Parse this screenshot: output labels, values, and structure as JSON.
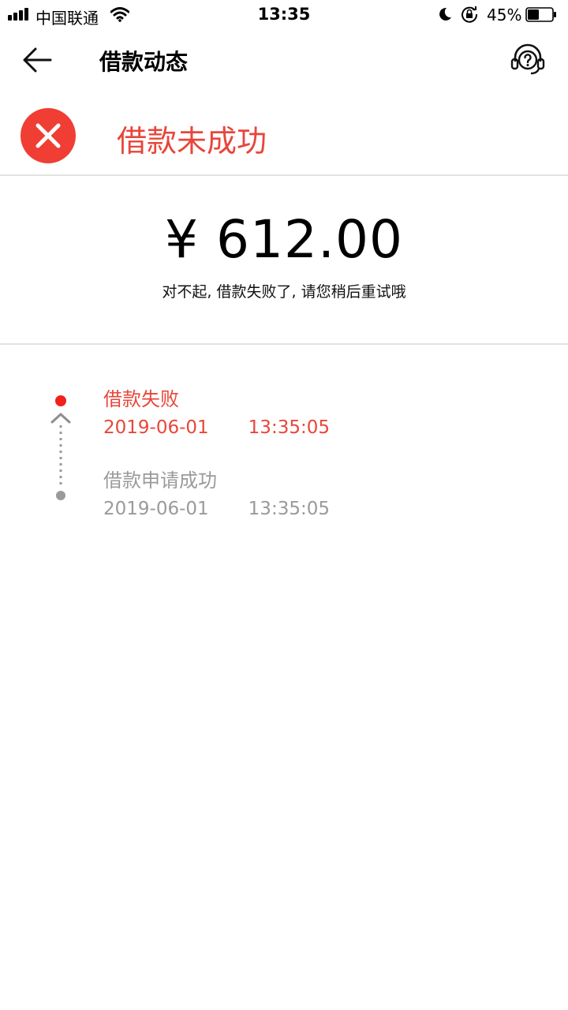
{
  "status_bar": {
    "carrier": "中国联通",
    "time": "13:35",
    "battery_percent": "45%",
    "battery_level": 0.45
  },
  "nav": {
    "title": "借款动态",
    "back_icon": "arrow-left-icon",
    "help_icon": "headset-help-icon"
  },
  "status_header": {
    "icon": "close-circle-icon",
    "title": "借款未成功",
    "accent_color": "#e8463b"
  },
  "amount": {
    "currency": "¥",
    "value": "612.00",
    "note": "对不起, 借款失败了, 请您稍后重试哦"
  },
  "timeline": [
    {
      "title": "借款失败",
      "date": "2019-06-01",
      "time": "13:35:05",
      "state": "active",
      "color": "#e8463b"
    },
    {
      "title": "借款申请成功",
      "date": "2019-06-01",
      "time": "13:35:05",
      "state": "done",
      "color": "#9a9a9a"
    }
  ]
}
